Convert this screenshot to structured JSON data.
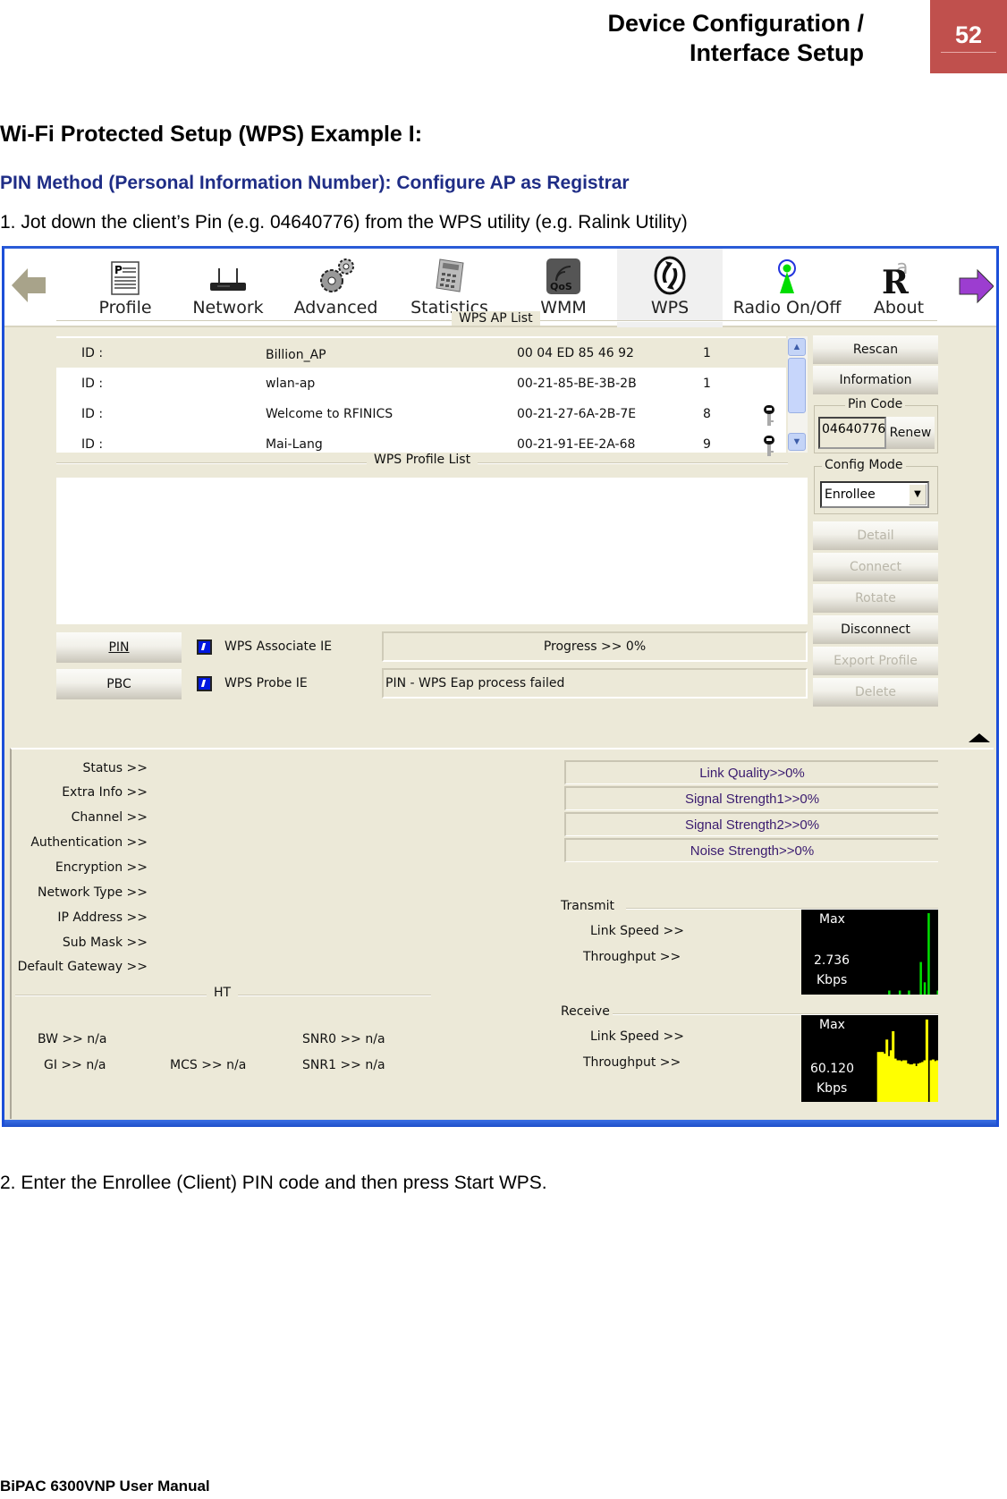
{
  "page_header": {
    "section_line1": "Device Configuration /",
    "section_line2": "Interface Setup",
    "page_number": "52"
  },
  "heading": "Wi-Fi Protected Setup (WPS) Example I:",
  "subheading": {
    "part1": "PIN Method (Personal Information Number): ",
    "part2": "Configure AP as Registrar"
  },
  "step1": "1. Jot down the client’s Pin (e.g. 04640776) from the WPS utility (e.g. Ralink Utility)",
  "step2": "2.  Enter the Enrollee (Client) PIN code and then press Start WPS.",
  "footer": "BiPAC 6300VNP User Manual",
  "utility": {
    "toolbar": {
      "items": [
        {
          "label": "Profile",
          "icon": "profile-icon"
        },
        {
          "label": "Network",
          "icon": "network-icon"
        },
        {
          "label": "Advanced",
          "icon": "gears-icon"
        },
        {
          "label": "Statistics",
          "icon": "calculator-icon"
        },
        {
          "label": "WMM",
          "icon": "qos-icon"
        },
        {
          "label": "WPS",
          "icon": "wps-icon",
          "active": true
        },
        {
          "label": "Radio On/Off",
          "icon": "radio-icon"
        },
        {
          "label": "About",
          "icon": "about-icon"
        }
      ]
    },
    "wps_ap_list": {
      "title": "WPS AP List",
      "rows": [
        {
          "id_label": "ID :",
          "ssid": "Billion_AP",
          "bssid": "00 04 ED 85 46 92",
          "channel": "1",
          "locked": false,
          "selected": true
        },
        {
          "id_label": "ID :",
          "ssid": "wlan-ap",
          "bssid": "00-21-85-BE-3B-2B",
          "channel": "1",
          "locked": false,
          "selected": false
        },
        {
          "id_label": "ID :",
          "ssid": "Welcome to RFINICS",
          "bssid": "00-21-27-6A-2B-7E",
          "channel": "8",
          "locked": true,
          "selected": false
        },
        {
          "id_label": "ID :",
          "ssid": "Mai-Lang",
          "bssid": "00-21-91-EE-2A-68",
          "channel": "9",
          "locked": true,
          "selected": false
        }
      ]
    },
    "wps_profile_list": {
      "title": "WPS Profile List"
    },
    "side_buttons": {
      "rescan": "Rescan",
      "information": "Information",
      "pin_code_legend": "Pin Code",
      "pin_code_value": "04640776",
      "renew": "Renew",
      "config_mode_legend": "Config Mode",
      "config_mode_value": "Enrollee",
      "detail": "Detail",
      "connect": "Connect",
      "rotate": "Rotate",
      "disconnect": "Disconnect",
      "export_profile": "Export Profile",
      "delete": "Delete"
    },
    "bottom_controls": {
      "pin_button": "PIN",
      "pbc_button": "PBC",
      "wps_associate_ie": {
        "label": "WPS Associate IE",
        "checked": true
      },
      "wps_probe_ie": {
        "label": "WPS Probe IE",
        "checked": true
      },
      "progress_text": "Progress >> 0%",
      "progress_value_percent": 0,
      "status_text": "PIN - WPS Eap process failed"
    },
    "link_info": {
      "labels": [
        "Status >>",
        "Extra Info >>",
        "Channel >>",
        "Authentication >>",
        "Encryption >>",
        "Network Type >>",
        "IP Address >>",
        "Sub Mask >>",
        "Default Gateway >>"
      ]
    },
    "meters": [
      {
        "label": "Link Quality>>0%",
        "value_percent": 0
      },
      {
        "label": "Signal Strength1>>0%",
        "value_percent": 0
      },
      {
        "label": "Signal Strength2>>0%",
        "value_percent": 0
      },
      {
        "label": "Noise Strength>>0%",
        "value_percent": 0
      }
    ],
    "ht": {
      "title": "HT",
      "bw": "BW >> n/a",
      "gi": "GI >> n/a",
      "mcs": "MCS >> n/a",
      "snr0": "SNR0 >> n/a",
      "snr1": "SNR1 >> n/a"
    },
    "transmit": {
      "title": "Transmit",
      "link_speed": "Link Speed >>",
      "throughput": "Throughput >>",
      "graph_max": "Max",
      "graph_value": "2.736",
      "graph_unit": "Kbps",
      "graph_color": "#00e000",
      "samples": [
        0,
        0,
        0,
        0,
        0,
        0,
        0,
        0,
        0,
        0,
        0,
        0,
        0,
        0,
        0,
        0,
        0,
        0,
        0,
        0,
        0,
        0,
        0,
        0,
        0,
        0,
        0,
        0,
        0,
        0,
        0,
        0,
        0,
        0,
        0,
        0,
        0,
        0,
        0,
        0,
        0,
        0,
        0,
        0,
        0,
        0,
        0,
        0,
        0,
        0,
        0,
        0,
        0,
        0,
        0,
        0,
        0,
        0,
        0,
        0,
        0,
        0,
        0,
        0,
        0,
        0,
        0.05,
        0,
        0,
        0,
        0,
        0,
        0,
        0,
        0.05,
        0,
        0,
        0,
        0,
        0,
        0,
        0.05,
        0,
        0,
        0,
        0,
        0,
        0,
        0,
        0,
        0.4,
        0,
        0,
        0.15,
        0,
        0,
        1.0,
        0,
        0,
        0,
        0,
        0,
        0,
        0.05
      ]
    },
    "receive": {
      "title": "Receive",
      "link_speed": "Link Speed >>",
      "throughput": "Throughput >>",
      "graph_max": "Max",
      "graph_value": "60.120",
      "graph_unit": "Kbps",
      "graph_color": "#ffff00",
      "samples": [
        0,
        0,
        0,
        0,
        0,
        0,
        0,
        0,
        0,
        0,
        0,
        0,
        0,
        0,
        0,
        0,
        0,
        0,
        0,
        0,
        0,
        0,
        0,
        0,
        0,
        0,
        0,
        0,
        0,
        0,
        0,
        0,
        0,
        0,
        0,
        0,
        0.6,
        0.6,
        0.6,
        0.58,
        0.75,
        0.55,
        0.62,
        0.85,
        0.52,
        0.5,
        0.5,
        0.49,
        0.5,
        0.5,
        0.46,
        0.45,
        0.45,
        0.46,
        0.43,
        0.46,
        0.47,
        0.48,
        0.5,
        0.99,
        0,
        0.5,
        0.51,
        0.49,
        0.5
      ]
    }
  }
}
